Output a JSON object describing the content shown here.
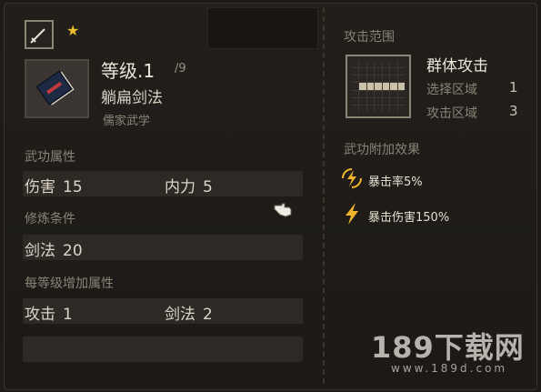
{
  "skill": {
    "level_label": "等级.1",
    "level_max": "/9",
    "name": "躺扁剑法",
    "school": "儒家武学",
    "rating_icon": "star-icon",
    "type_icon": "sword-icon"
  },
  "attributes": {
    "title": "武功属性",
    "damage_label": "伤害",
    "damage_value": "15",
    "inner_label": "内力",
    "inner_value": "5"
  },
  "requirements": {
    "title": "修炼条件",
    "sword_label": "剑法",
    "sword_value": "20"
  },
  "per_level": {
    "title": "每等级增加属性",
    "attack_label": "攻击",
    "attack_value": "1",
    "sword_label": "剑法",
    "sword_value": "2"
  },
  "attack_range": {
    "title": "攻击范围",
    "type": "群体攻击",
    "select_label": "选择区域",
    "select_value": "1",
    "attack_label": "攻击区域",
    "attack_value": "3"
  },
  "effects": {
    "title": "武功附加效果",
    "items": [
      {
        "text": "暴击率5%",
        "icon": "lightning-circle-icon"
      },
      {
        "text": "暴击伤害150%",
        "icon": "lightning-icon"
      }
    ]
  },
  "watermark": {
    "main": "189下载网",
    "sub": "www.189d.com"
  },
  "colors": {
    "background": "#1d1a17",
    "star": "#e9bd2d",
    "lightning": "#f0b52a",
    "book_stripe": "#c0393b"
  }
}
